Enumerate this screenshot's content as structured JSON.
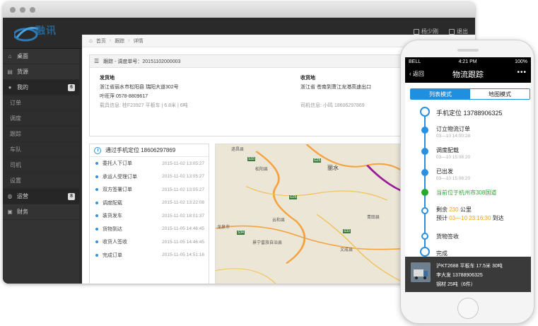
{
  "header": {
    "logo_text": "融讯",
    "user": "杨少刚",
    "logout": "退出"
  },
  "sidebar": {
    "items": [
      {
        "label": "桌面",
        "icon": "home-icon"
      },
      {
        "label": "货源",
        "icon": "list-icon"
      },
      {
        "label": "我的",
        "icon": "user-icon",
        "badge": "6"
      },
      {
        "label": "订单",
        "sub": true
      },
      {
        "label": "调度",
        "sub": true
      },
      {
        "label": "跟踪",
        "sub": true
      },
      {
        "label": "车队",
        "sub": true
      },
      {
        "label": "司机",
        "sub": true
      },
      {
        "label": "设置",
        "sub": true
      },
      {
        "label": "运营",
        "icon": "globe-icon",
        "badge": "8"
      },
      {
        "label": "财务",
        "icon": "wallet-icon"
      }
    ]
  },
  "breadcrumb": {
    "home": "首页",
    "track": "跟踪",
    "detail": "详情"
  },
  "order": {
    "header": "跟踪 - 调度单号：20151102000003",
    "sender_label": "发货地",
    "sender_address": "浙江省丽水市松阳县 瑞阳大道302号",
    "sender_contact": "叶旺萍 0578-8809617",
    "vehicle_info": "载具信息: 桂F23927 平板车 | 6.8米 | 6吨",
    "receiver_label": "收货地",
    "receiver_address": "浙江省 苍南到萧江龙港高速出口",
    "driver_info": "司机信息: 小鸣 18606297869"
  },
  "tracking": {
    "header": "通过手机定位 18606297869",
    "rows": [
      {
        "label": "委托人下订单",
        "time": "2015-11-02 13:05:27"
      },
      {
        "label": "承运人受理订单",
        "time": "2015-11-02 13:05:27"
      },
      {
        "label": "双方签署订单",
        "time": "2015-11-02 13:05:27"
      },
      {
        "label": "调度配载",
        "time": "2015-11-02 13:22:08"
      },
      {
        "label": "装货发车",
        "time": "2015-11-02 18:01:37"
      },
      {
        "label": "货物到达",
        "time": "2015-11-05 14:46:45"
      },
      {
        "label": "收货人签收",
        "time": "2015-11-05 14:46:45"
      },
      {
        "label": "完成订单",
        "time": "2015-11-05 14:51:16"
      }
    ]
  },
  "map": {
    "labels": [
      "遂昌县",
      "松阳县",
      "丽水",
      "S33",
      "G25",
      "G25",
      "云和县",
      "景宁畲族自治县",
      "S34",
      "青田县",
      "龙泉市",
      "文成县",
      "S33"
    ]
  },
  "phone": {
    "carrier": "BELL",
    "time": "4:21 PM",
    "battery": "100%",
    "back": "返回",
    "title": "物流跟踪",
    "more": "•••",
    "tab_list": "列表模式",
    "tab_map": "地图模式",
    "timeline": {
      "phone": "手机定位 13788906325",
      "t1": "订立物流订单",
      "t1_time": "03—10 14:00:28",
      "t2": "调度配载",
      "t2_time": "03—10 15:08:20",
      "t3": "已出发",
      "t3_time": "03—10 15:08:20",
      "current": "当前位于杭州市308国道",
      "remain_prefix": "剩余",
      "remain_value": "230",
      "remain_unit": "公里",
      "eta_prefix": "预计",
      "eta_value": "03—10 23:16:30",
      "eta_suffix": "到达",
      "t5": "货物签收",
      "t6": "完成"
    },
    "driver": {
      "line1": "沪KT2688  平板车 17.5米 30吨",
      "line2": "李大发  13788906325",
      "line3": "钢材  25吨（6件）"
    }
  }
}
